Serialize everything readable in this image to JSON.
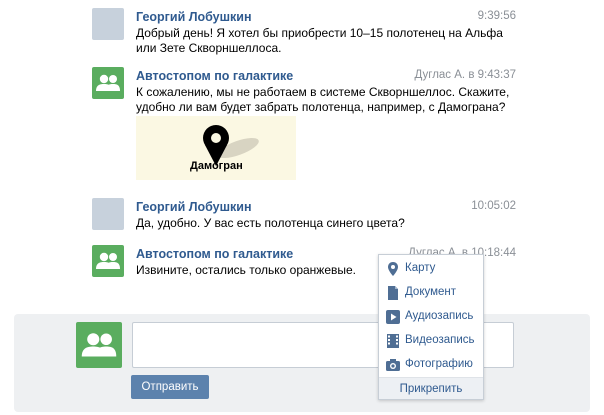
{
  "messages": [
    {
      "author": "Георгий Лобушкин",
      "time": "9:39:56",
      "text": "Добрый день! Я хотел бы приобрести 10–15 полотенец на Альфа или Зете Скворншеллоса."
    },
    {
      "author": "Автостопом по галактике",
      "time": "Дуглас А. в 9:43:37",
      "text": "К сожалению, мы не работаем в системе Скворншеллос. Скажите, удобно ли вам будет забрать полотенца, например, с Дамограна?"
    },
    {
      "author": "Георгий Лобушкин",
      "time": "10:05:02",
      "text": "Да, удобно. У вас есть полотенца синего цвета?"
    },
    {
      "author": "Автостопом по галактике",
      "time": "Дуглас А. в 10:18:44",
      "text": "Извините, остались только оранжевые."
    }
  ],
  "map_attachment": {
    "label": "Дамогран"
  },
  "compose": {
    "send_label": "Отправить"
  },
  "attach_menu": {
    "items": [
      {
        "label": "Карту",
        "icon": "map-pin-icon"
      },
      {
        "label": "Документ",
        "icon": "document-icon"
      },
      {
        "label": "Аудиозапись",
        "icon": "audio-icon"
      },
      {
        "label": "Видеозапись",
        "icon": "video-icon"
      },
      {
        "label": "Фотографию",
        "icon": "camera-icon"
      }
    ],
    "footer": "Прикрепить"
  },
  "colors": {
    "link": "#2f5a8f",
    "button": "#5c82ad",
    "group_avatar": "#5aad5f",
    "user_avatar": "#c7d1dc"
  }
}
